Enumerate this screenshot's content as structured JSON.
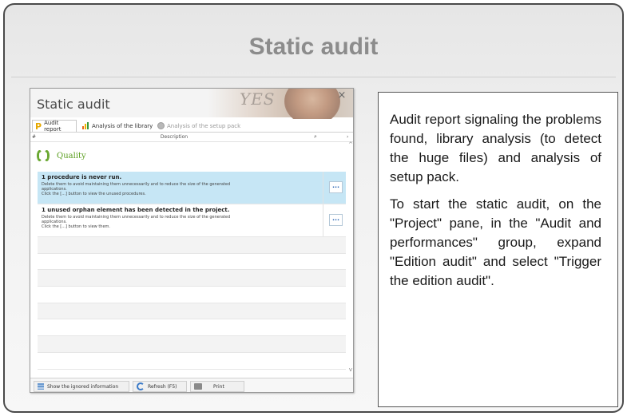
{
  "slide": {
    "title": "Static audit"
  },
  "window": {
    "title": "Static audit",
    "banner_text": "YES",
    "close_label": "×",
    "tabs": [
      {
        "label": "Audit report",
        "icon": "p-icon",
        "active": true
      },
      {
        "label": "Analysis of the library",
        "icon": "bar-chart-icon",
        "active": false
      },
      {
        "label": "Analysis of the setup pack",
        "icon": "gear-icon",
        "active": false,
        "disabled": true
      }
    ],
    "column_header": {
      "hash": "#",
      "description": "Description",
      "search_icon": "⌕",
      "arrow": "›"
    },
    "section": {
      "label": "Quality",
      "icon": "laurel-icon"
    },
    "items": [
      {
        "title": "1 procedure is never run.",
        "line1": "Delete them to avoid maintaining them unnecessarily and to reduce the size of the generated",
        "line2": "applications.",
        "line3": "Click the [...] button to view the unused procedures.",
        "button": "...",
        "selected": true
      },
      {
        "title": "1 unused orphan element has been detected in the project.",
        "line1": "Delete them to avoid maintaining them unnecessarily and to reduce the size of the generated",
        "line2": "applications.",
        "line3": "Click the [...] button to view them.",
        "button": "...",
        "selected": false
      }
    ],
    "scroll_up": "^",
    "scroll_down": "v",
    "bottom_buttons": {
      "ignored": "Show the ignored information",
      "refresh": "Refresh (F5)",
      "print": "Print"
    }
  },
  "description": {
    "paragraph1": "Audit report signaling the problems found, library analysis (to detect the huge files) and analysis of setup pack.",
    "paragraph2": "To start the static audit, on the \"Project\" pane, in the \"Audit and performances\" group, expand \"Edition audit\" and select \"Trigger the edition audit\"."
  },
  "colors": {
    "title_gray": "#8c8c8c",
    "selected_row": "#c6e6f5",
    "quality_green": "#5a9e1e",
    "link_blue": "#2a66b4"
  }
}
